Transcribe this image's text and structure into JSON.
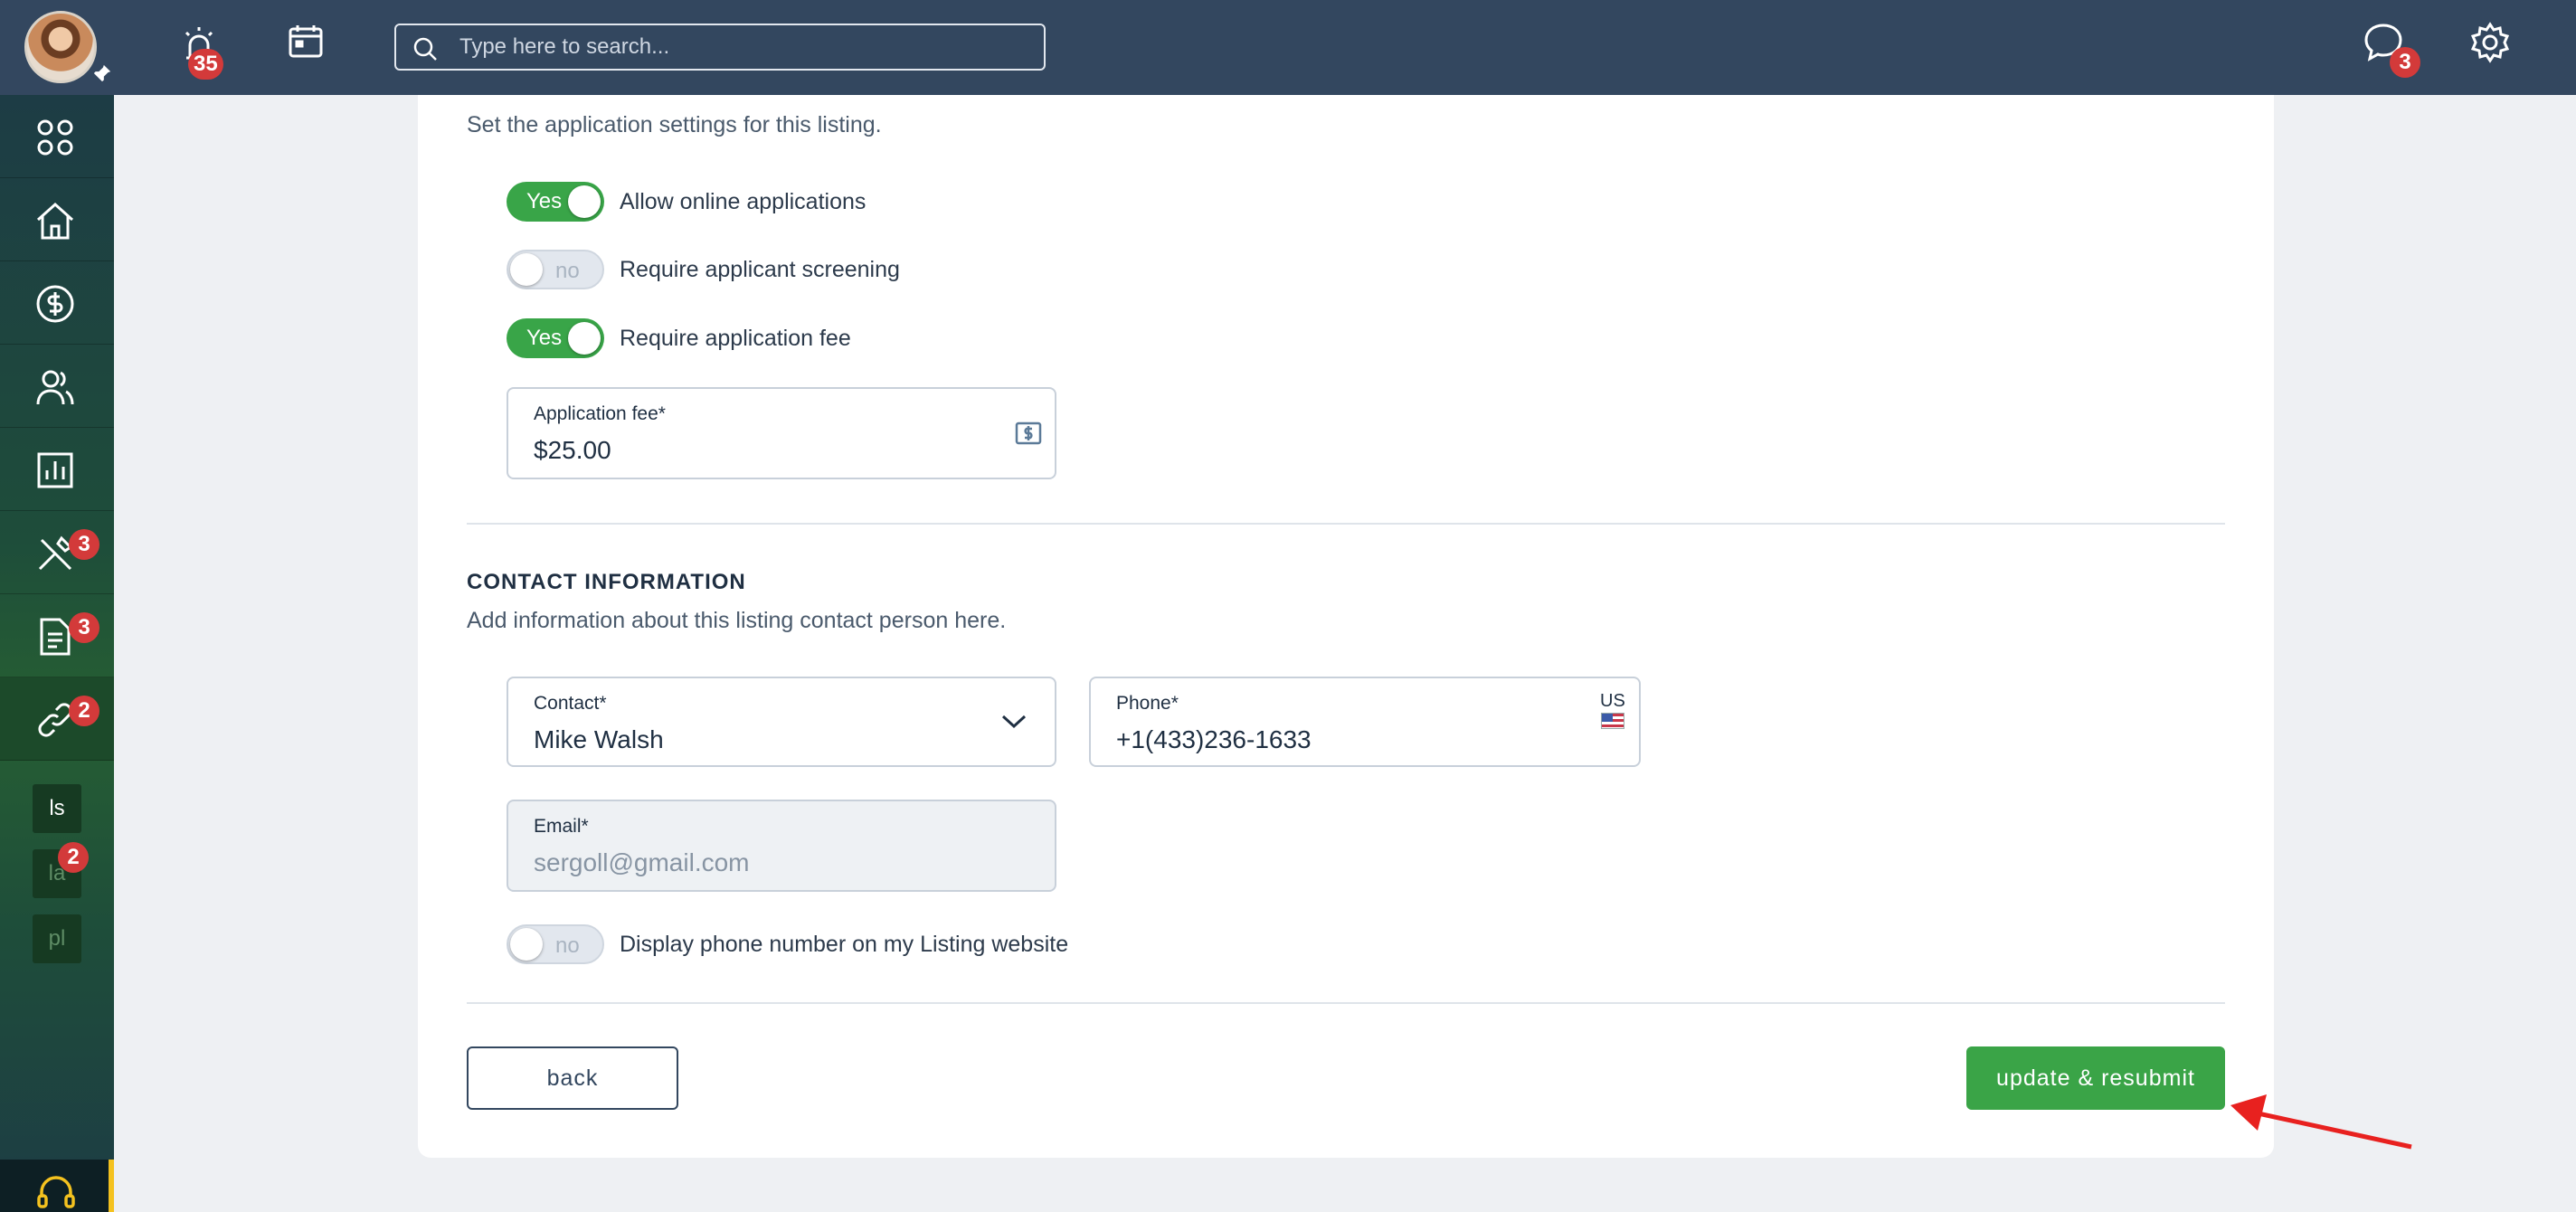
{
  "topbar": {
    "alerts_badge": "35",
    "search_placeholder": "Type here to search...",
    "messages_badge": "3"
  },
  "sidebar": {
    "maintenance_badge": "3",
    "documents_badge": "3",
    "listings_badge": "2",
    "sub_items": [
      {
        "label": "ls",
        "badge": ""
      },
      {
        "label": "la",
        "badge": "2"
      },
      {
        "label": "pl",
        "badge": ""
      }
    ]
  },
  "application_settings": {
    "description": "Set the application settings for this listing.",
    "toggles": [
      {
        "state": "Yes",
        "label": "Allow online applications"
      },
      {
        "state": "no",
        "label": "Require applicant screening"
      },
      {
        "state": "Yes",
        "label": "Require application fee"
      }
    ],
    "fee_field": {
      "label": "Application fee*",
      "value": "$25.00"
    }
  },
  "contact_information": {
    "title": "CONTACT INFORMATION",
    "description": "Add information about this listing contact person here.",
    "contact_field": {
      "label": "Contact*",
      "value": "Mike Walsh"
    },
    "phone_field": {
      "label": "Phone*",
      "value": "+1(433)236-1633",
      "country": "US"
    },
    "email_field": {
      "label": "Email*",
      "value": "sergoll@gmail.com"
    },
    "display_phone_toggle": {
      "state": "no",
      "label": "Display phone number on my Listing website"
    }
  },
  "actions": {
    "back_label": "back",
    "submit_label": "update & resubmit"
  },
  "colors": {
    "topbar": "#33475f",
    "accent_green": "#3aa447",
    "badge_red": "#d33a3a",
    "annotation_arrow": "#e8211f"
  }
}
